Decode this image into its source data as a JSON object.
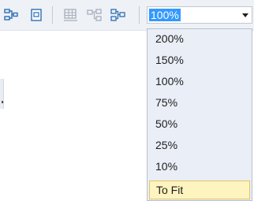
{
  "toolbar": {
    "buttons": [
      {
        "icon": "layout-icon"
      },
      {
        "icon": "page-icon"
      },
      {
        "icon": "grid-icon"
      },
      {
        "icon": "connector-left-icon"
      },
      {
        "icon": "connector-right-icon"
      }
    ]
  },
  "zoom": {
    "value": "100%",
    "options": [
      "200%",
      "150%",
      "100%",
      "75%",
      "50%",
      "25%",
      "10%",
      "To Fit"
    ],
    "highlighted": "To Fit"
  },
  "colors": {
    "selection": "#3399ff",
    "dropdown_bg": "#e9eef7",
    "hover_bg": "#fdf4bf",
    "hover_border": "#e5c365",
    "icon_blue": "#2c6fb5"
  }
}
